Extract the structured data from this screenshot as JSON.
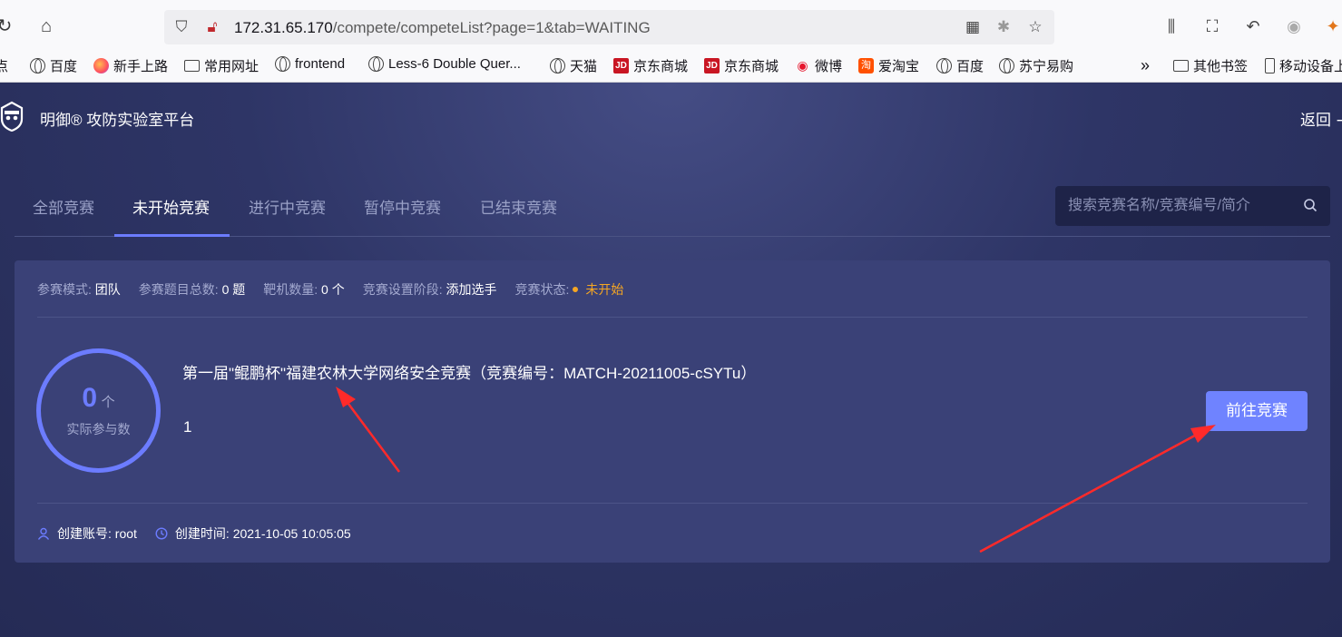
{
  "browser": {
    "url_host": "172.31.65.170",
    "url_path": "/compete/competeList?page=1&tab=WAITING",
    "bookmarks": [
      {
        "label": "点",
        "icon": "partial-icon"
      },
      {
        "label": "百度",
        "icon": "globe-icon"
      },
      {
        "label": "新手上路",
        "icon": "firefox-icon"
      },
      {
        "label": "常用网址",
        "icon": "folder-icon"
      },
      {
        "label": "frontend",
        "icon": "globe-icon"
      },
      {
        "label": "Less-6 Double Quer...",
        "icon": "globe-icon"
      },
      {
        "label": "天猫",
        "icon": "globe-icon"
      },
      {
        "label": "京东商城",
        "icon": "jd-icon"
      },
      {
        "label": "京东商城",
        "icon": "jd-icon"
      },
      {
        "label": "微博",
        "icon": "weibo-icon"
      },
      {
        "label": "爱淘宝",
        "icon": "taobao-icon"
      },
      {
        "label": "百度",
        "icon": "globe-icon"
      },
      {
        "label": "苏宁易购",
        "icon": "globe-icon"
      }
    ],
    "more_bookmarks": "»",
    "other_bookmarks": "其他书签",
    "mobile_bookmarks": "移动设备上"
  },
  "app": {
    "title": "明御® 攻防实验室平台",
    "back": "返回 ∹",
    "tabs": [
      {
        "label": "全部竞赛",
        "active": false
      },
      {
        "label": "未开始竞赛",
        "active": true
      },
      {
        "label": "进行中竞赛",
        "active": false
      },
      {
        "label": "暂停中竞赛",
        "active": false
      },
      {
        "label": "已结束竞赛",
        "active": false
      }
    ],
    "search": {
      "placeholder": "搜索竞赛名称/竞赛编号/简介",
      "value": ""
    }
  },
  "card": {
    "meta": {
      "mode_label": "参赛模式:",
      "mode_value": "团队",
      "questions_label": "参赛题目总数:",
      "questions_value": "0 题",
      "targets_label": "靶机数量:",
      "targets_value": "0 个",
      "stage_label": "竞赛设置阶段:",
      "stage_value": "添加选手",
      "status_label": "竞赛状态:",
      "status_value": "未开始"
    },
    "participants": {
      "count": "0",
      "unit": "个",
      "caption": "实际参与数"
    },
    "title": "第一届\"鲲鹏杯\"福建农林大学网络安全竞赛（竞赛编号：MATCH-20211005-cSYTu）",
    "description": "1",
    "go_button": "前往竞赛",
    "creator_label": "创建账号:",
    "creator_value": "root",
    "created_label": "创建时间:",
    "created_value": "2021-10-05 10:05:05"
  },
  "colors": {
    "accent": "#6c7cff",
    "status_warning": "#f5a623",
    "annotation_arrow": "#ff2a2a"
  }
}
